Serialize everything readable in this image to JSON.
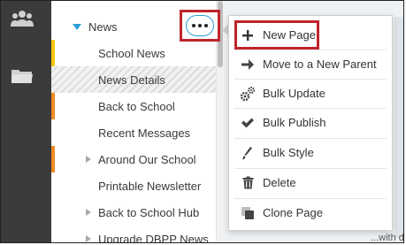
{
  "colors": {
    "rail": "#3b3b3b",
    "accent_blue": "#2a9fd6",
    "highlight_red": "#c0242c",
    "bar_yellow": "#f2c811",
    "bar_orange": "#f08a24"
  },
  "rail": {
    "icons": [
      "users-icon",
      "folder-icon"
    ]
  },
  "tree": {
    "parent": {
      "label": "News",
      "expanded": true
    },
    "items": [
      {
        "label": "School News",
        "has_children": false,
        "bar": "yellow"
      },
      {
        "label": "News Details",
        "has_children": false,
        "hatched": true
      },
      {
        "label": "Back to School",
        "has_children": false,
        "bar": "orange"
      },
      {
        "label": "Recent Messages",
        "has_children": false
      },
      {
        "label": "Around Our School",
        "has_children": true,
        "bar": "orange"
      },
      {
        "label": "Printable Newsletter",
        "has_children": false
      },
      {
        "label": "Back to School Hub",
        "has_children": true
      },
      {
        "label": "Upgrade DBPP News",
        "has_children": true
      }
    ]
  },
  "ellipsis_button": {
    "icon": "more-horizontal-icon"
  },
  "menu": {
    "items": [
      {
        "label": "New Page",
        "icon": "plus-icon"
      },
      {
        "label": "Move to a New Parent",
        "icon": "arrow-right-icon"
      },
      {
        "label": "Bulk Update",
        "icon": "gears-icon"
      },
      {
        "label": "Bulk Publish",
        "icon": "check-icon"
      },
      {
        "label": "Bulk Style",
        "icon": "brush-icon"
      },
      {
        "label": "Delete",
        "icon": "trash-icon"
      },
      {
        "label": "Clone Page",
        "icon": "clone-icon"
      }
    ]
  },
  "background_peek_text": "...with d"
}
